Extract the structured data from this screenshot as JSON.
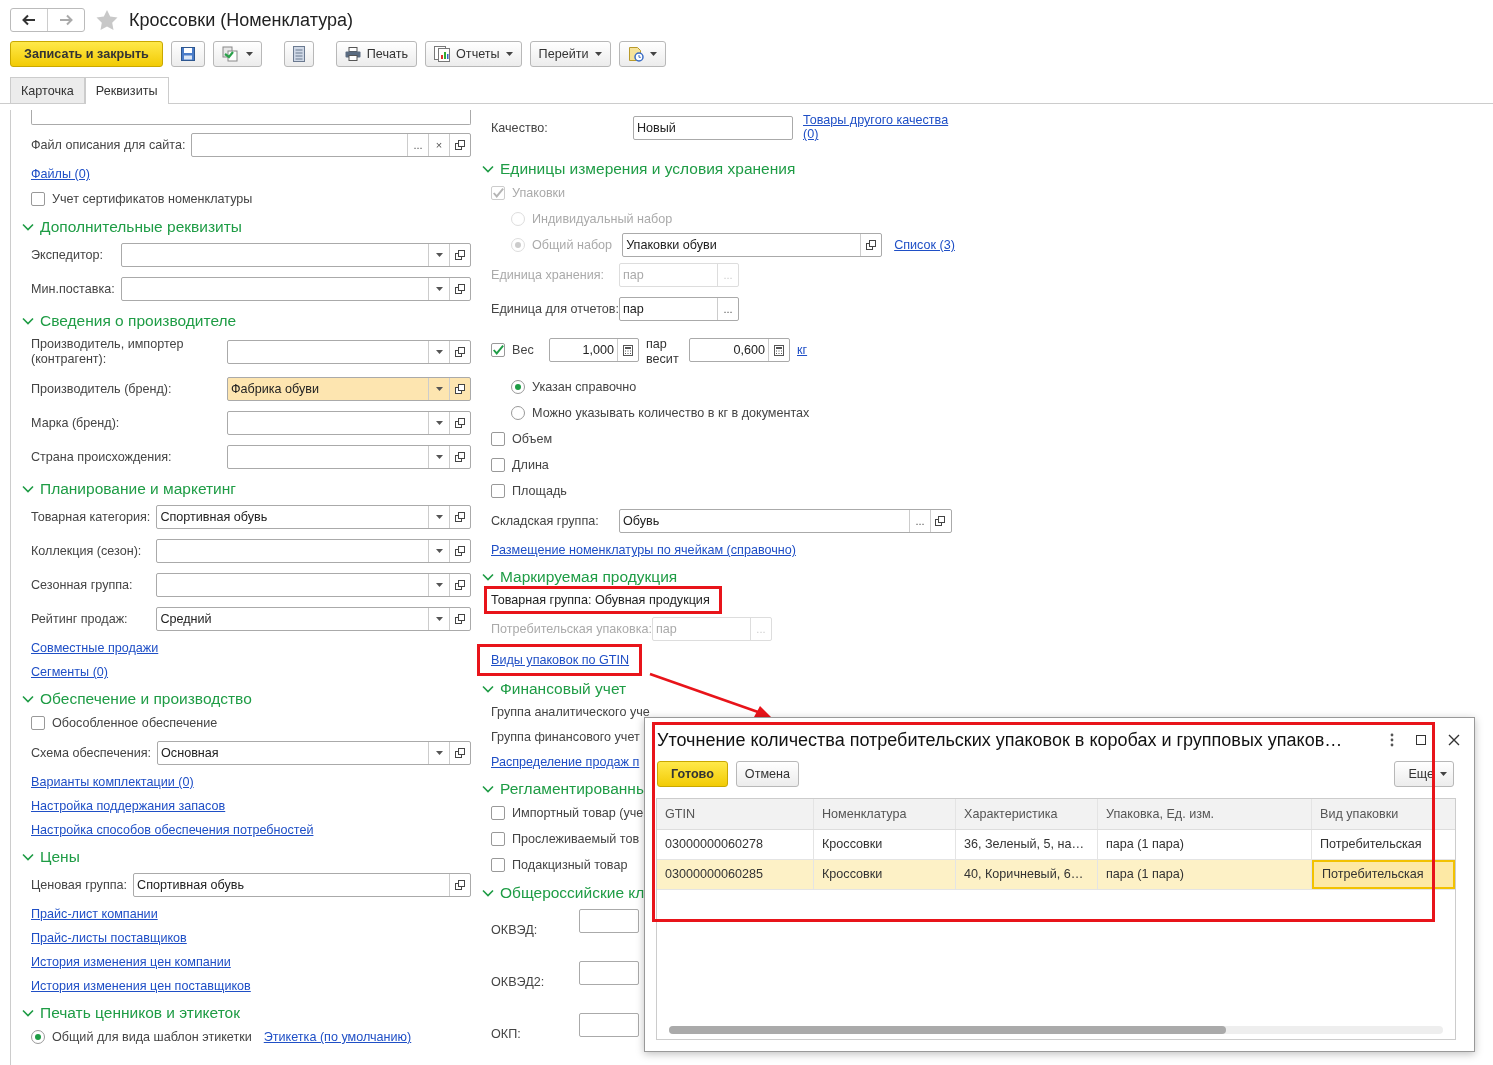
{
  "title": "Кроссовки (Номенклатура)",
  "toolbar": [
    {
      "kind": "primary",
      "label": "Записать и закрыть"
    },
    {
      "kind": "icon"
    },
    {
      "kind": "icon",
      "dropdown": true
    },
    {
      "kind": "icon"
    },
    {
      "kind": "text",
      "label": "Печать"
    },
    {
      "kind": "text",
      "label": "Отчеты",
      "dropdown": true
    },
    {
      "kind": "text",
      "label": "Перейти",
      "dropdown": true
    },
    {
      "kind": "icon",
      "dropdown": true
    }
  ],
  "tabs": [
    {
      "label": "Карточка",
      "selected": false
    },
    {
      "label": "Реквизиты",
      "selected": true
    }
  ],
  "columns": [
    {
      "items": [
        {
          "kind": "area"
        },
        {
          "kind": "field",
          "label": "Файл описания для сайта:",
          "choice_button": "...",
          "clear_button": "×",
          "open_button": true
        },
        {
          "kind": "link",
          "text": "Файлы (0)"
        },
        {
          "kind": "checkbox",
          "label": "Учет сертификатов номенклатуры",
          "checked": false
        }
      ],
      "sections": [
        {
          "title": "Дополнительные реквизиты",
          "expanded": true,
          "items": [
            {
              "kind": "field",
              "label": "Экспедитор:",
              "dropdown": true,
              "open_button": true
            },
            {
              "kind": "field",
              "label": "Мин.поставка:",
              "dropdown": true,
              "open_button": true
            }
          ]
        },
        {
          "title": "Сведения о производителе",
          "expanded": true,
          "items": [
            {
              "kind": "field",
              "label": "Производитель, импортер (контрагент):",
              "dropdown": true,
              "open_button": true
            },
            {
              "kind": "field",
              "label": "Производитель (бренд):",
              "value": "Фабрика обуви",
              "focused": true,
              "dropdown": true,
              "open_button": true
            },
            {
              "kind": "field",
              "label": "Марка (бренд):",
              "dropdown": true,
              "open_button": true
            },
            {
              "kind": "field",
              "label": "Страна происхождения:",
              "dropdown": true,
              "open_button": true
            }
          ]
        },
        {
          "title": "Планирование и маркетинг",
          "expanded": true,
          "items": [
            {
              "kind": "field",
              "label": "Товарная категория:",
              "value": "Спортивная обувь",
              "dropdown": true,
              "open_button": true
            },
            {
              "kind": "field",
              "label": "Коллекция (сезон):",
              "dropdown": true,
              "open_button": true
            },
            {
              "kind": "field",
              "label": "Сезонная группа:",
              "dropdown": true,
              "open_button": true
            },
            {
              "kind": "field",
              "label": "Рейтинг продаж:",
              "value": "Средний",
              "dropdown": true,
              "open_button": true
            },
            {
              "kind": "link",
              "text": "Совместные продажи"
            },
            {
              "kind": "link",
              "text": "Сегменты (0)"
            }
          ]
        },
        {
          "title": "Обеспечение и производство",
          "expanded": true,
          "items": [
            {
              "kind": "checkbox",
              "label": "Обособленное обеспечение",
              "checked": false
            },
            {
              "kind": "field",
              "label": "Схема обеспечения:",
              "value": "Основная",
              "dropdown": true,
              "open_button": true
            },
            {
              "kind": "link",
              "text": "Варианты комплектации (0)"
            },
            {
              "kind": "link",
              "text": "Настройка поддержания запасов"
            },
            {
              "kind": "link",
              "text": "Настройка способов обеспечения потребностей"
            }
          ]
        },
        {
          "title": "Цены",
          "expanded": true,
          "items": [
            {
              "kind": "field",
              "label": "Ценовая группа:",
              "value": "Спортивная обувь",
              "open_button": true
            },
            {
              "kind": "link",
              "text": "Прайс-лист компании"
            },
            {
              "kind": "link",
              "text": "Прайс-листы поставщиков"
            },
            {
              "kind": "link",
              "text": "История изменения цен компании"
            },
            {
              "kind": "link",
              "text": "История изменения цен поставщиков"
            }
          ]
        },
        {
          "title": "Печать ценников и этикеток",
          "expanded": true,
          "items": [
            {
              "kind": "radio",
              "label": "Общий для вида шаблон этикетки",
              "selected": true,
              "link": "Этикетка (по умолчанию)"
            }
          ]
        }
      ]
    },
    {
      "items": [
        {
          "kind": "field",
          "label": "Качество:",
          "value": "Новый",
          "link": "Товары другого качества (0)"
        }
      ],
      "sections": [
        {
          "title": "Единицы измерения и условия хранения",
          "expanded": true,
          "items": [
            {
              "kind": "checkbox",
              "label": "Упаковки",
              "checked": true,
              "disabled": true
            },
            {
              "kind": "radio",
              "label": "Индивидуальный набор",
              "selected": false,
              "disabled": true
            },
            {
              "kind": "radio",
              "label": "Общий набор",
              "selected": true,
              "disabled": true,
              "field": {
                "value": "Упаковки обуви",
                "open_button": true
              },
              "link": "Список (3)"
            },
            {
              "kind": "field",
              "label": "Единица хранения:",
              "value": "пар",
              "choice_button": "...",
              "disabled": true
            },
            {
              "kind": "field",
              "label": "Единица для отчетов:",
              "value": "пар",
              "choice_button": "..."
            },
            {
              "kind": "weight",
              "label": "Вес",
              "checked": true,
              "amount": "1,000",
              "unit_text": "пар весит",
              "weight": "0,600",
              "unit_link": "кг"
            },
            {
              "kind": "radio",
              "label": "Указан справочно",
              "selected": true,
              "indent": true
            },
            {
              "kind": "radio",
              "label": "Можно указывать количество в кг в документах",
              "selected": false,
              "indent": true
            },
            {
              "kind": "checkbox",
              "label": "Объем",
              "checked": false
            },
            {
              "kind": "checkbox",
              "label": "Длина",
              "checked": false
            },
            {
              "kind": "checkbox",
              "label": "Площадь",
              "checked": false
            },
            {
              "kind": "field",
              "label": "Складская группа:",
              "value": "Обувь",
              "choice_button": "...",
              "open_button": true,
              "wide": true
            },
            {
              "kind": "link",
              "text": "Размещение номенклатуры по ячейкам (справочно)"
            }
          ]
        },
        {
          "title": "Маркируемая продукция",
          "expanded": true,
          "items": [
            {
              "kind": "text",
              "text": "Товарная группа: Обувная продукция",
              "annotated": true
            },
            {
              "kind": "field",
              "label": "Потребительская упаковка:",
              "value": "пар",
              "choice_button": "...",
              "disabled": true
            },
            {
              "kind": "link",
              "text": "Виды упаковок по GTIN",
              "annotated": true
            }
          ]
        },
        {
          "title": "Финансовый учет",
          "expanded": true,
          "items": [
            {
              "kind": "caption",
              "text": "Группа аналитического уче"
            },
            {
              "kind": "caption",
              "text": "Группа финансового учет"
            },
            {
              "kind": "link",
              "text": "Распределение продаж п"
            }
          ]
        },
        {
          "title": "Регламентированны",
          "expanded": true,
          "items": [
            {
              "kind": "checkbox",
              "label": "Импортный товар (уче",
              "checked": false
            },
            {
              "kind": "checkbox",
              "label": "Прослеживаемый тов",
              "checked": false
            },
            {
              "kind": "checkbox",
              "label": "Подакцизный товар",
              "checked": false
            }
          ]
        },
        {
          "title": "Общероссийские кл",
          "expanded": true,
          "items": [
            {
              "kind": "field",
              "label": "ОКВЭД:"
            },
            {
              "kind": "field",
              "label": "ОКВЭД2:"
            },
            {
              "kind": "field",
              "label": "ОКП:"
            }
          ]
        }
      ]
    }
  ],
  "dialog": {
    "title": "Уточнение количества потребительских упаковок в коробах и групповых упаков…",
    "annotated": true,
    "buttons": [
      {
        "kind": "primary",
        "label": "Готово"
      },
      {
        "kind": "default",
        "label": "Отмена"
      }
    ],
    "more": "Еще",
    "columns": [
      "GTIN",
      "Номенклатура",
      "Характеристика",
      "Упаковка, Ед. изм.",
      "Вид упаковки"
    ],
    "rows": [
      {
        "selected": false,
        "cells": [
          "03000000060278",
          "Кроссовки",
          "36, Зеленый, 5, на…",
          "пара (1 пара)",
          "Потребительская"
        ]
      },
      {
        "selected": true,
        "cells": [
          "03000000060285",
          "Кроссовки",
          "40, Коричневый, 6…",
          "пара (1 пара)",
          "Потребительская"
        ]
      }
    ]
  }
}
